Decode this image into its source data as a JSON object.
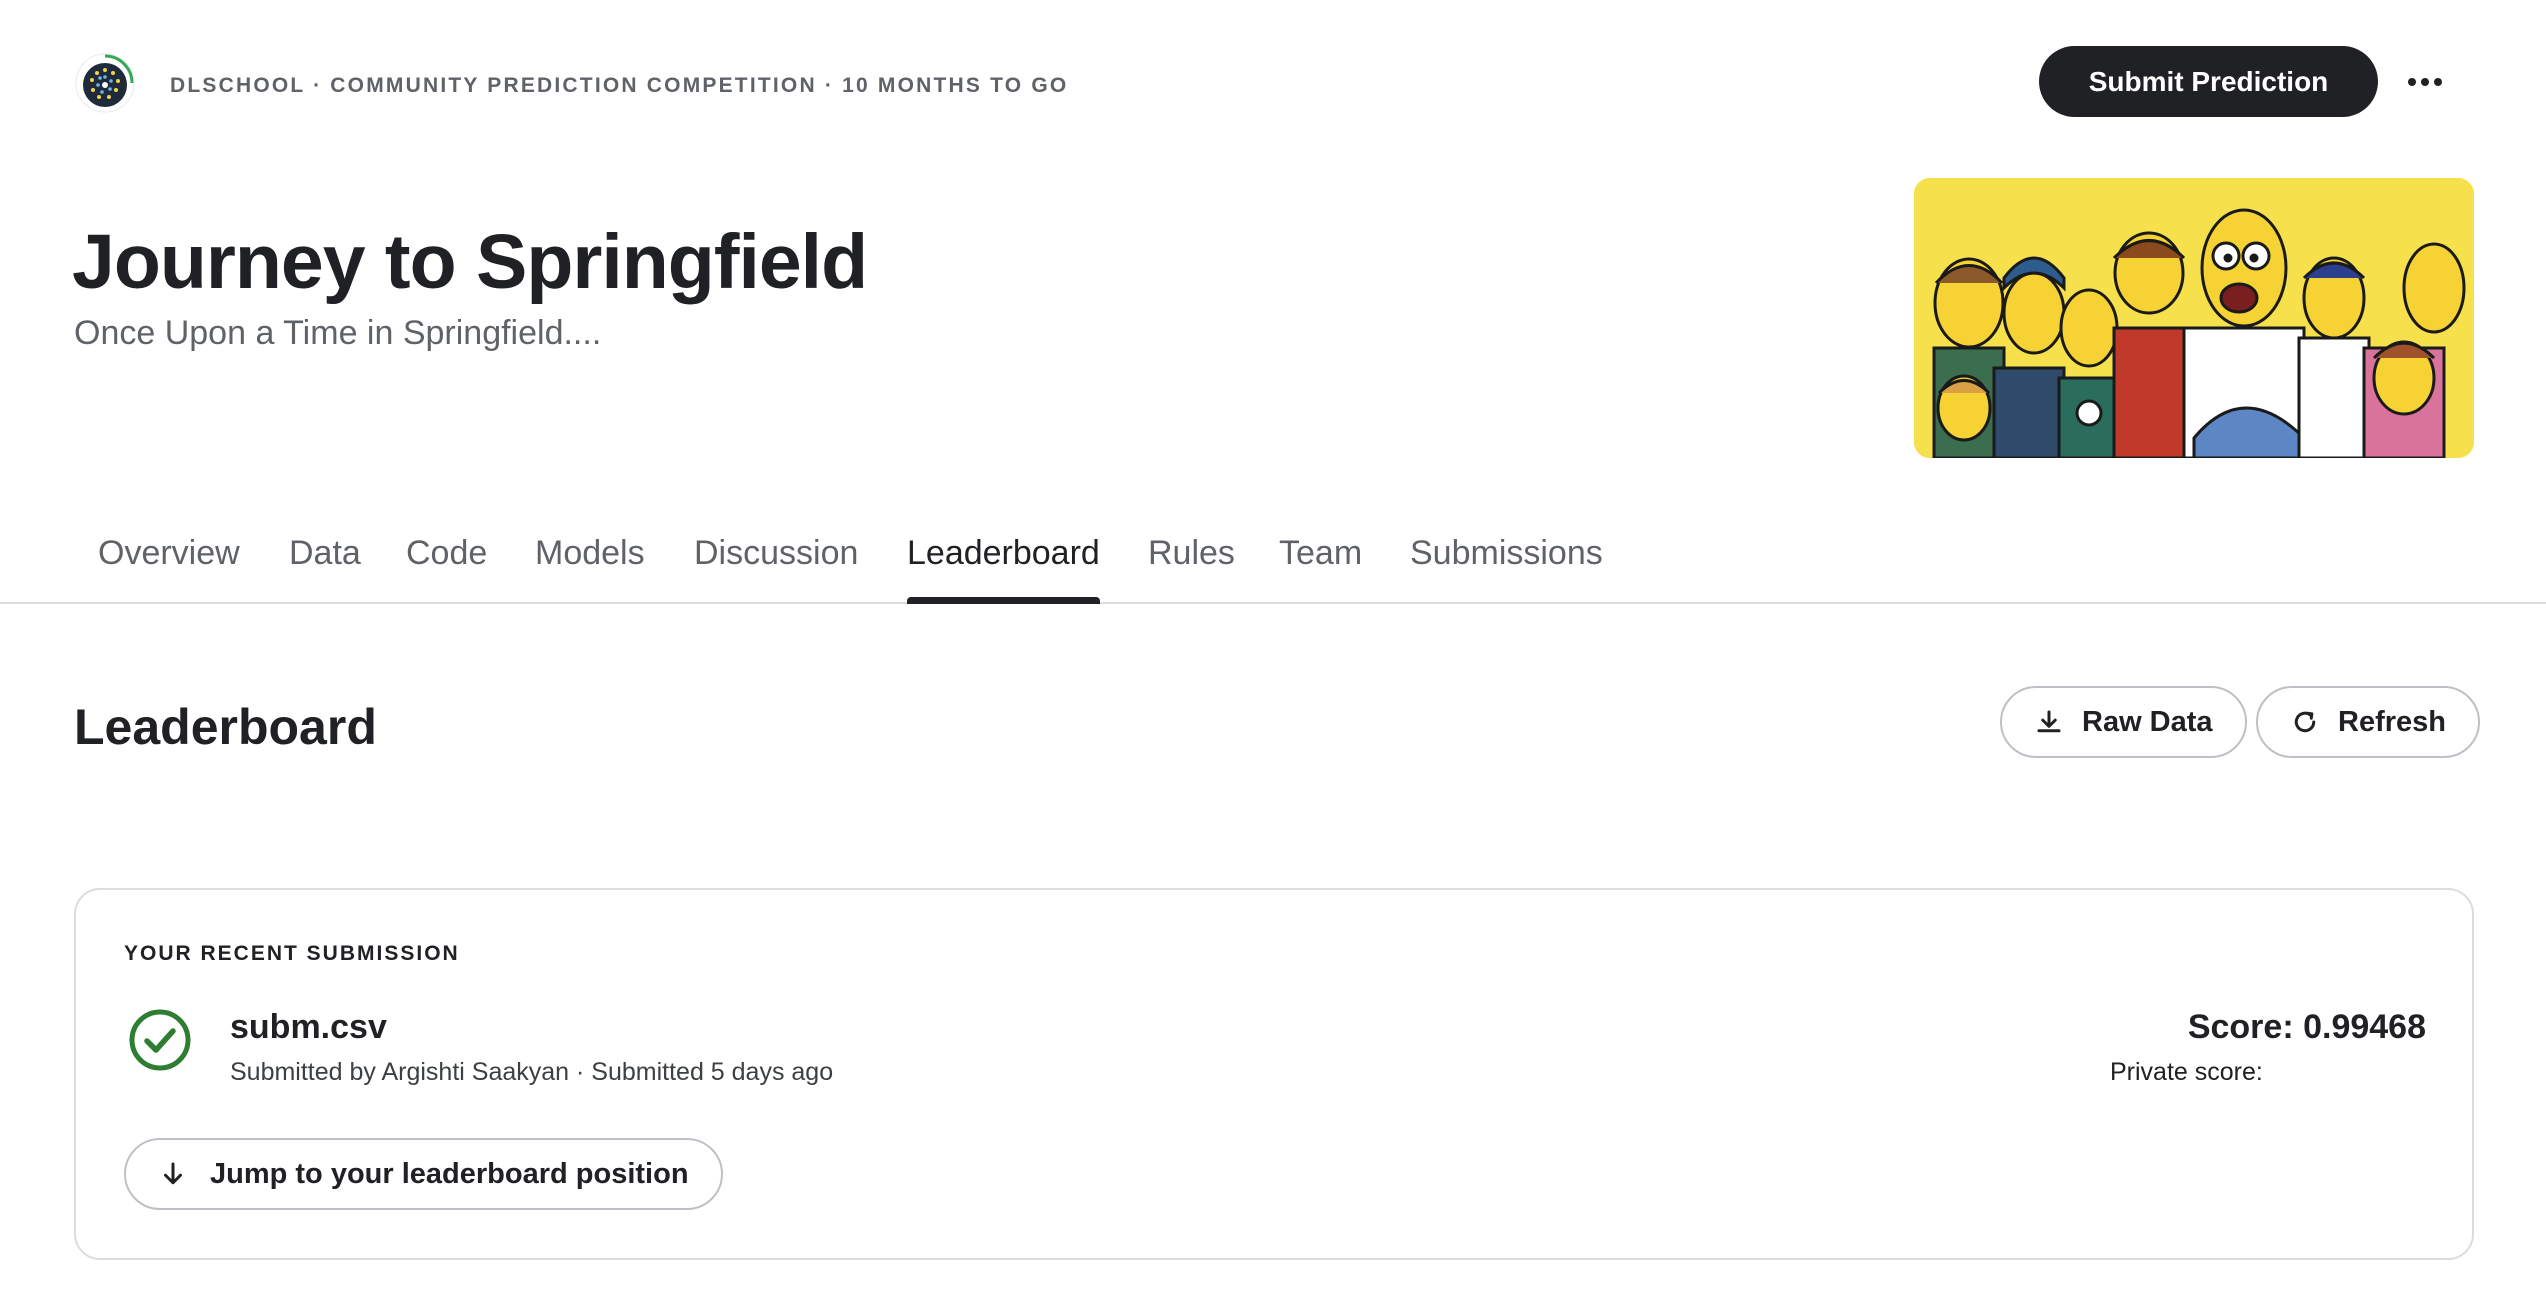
{
  "header": {
    "meta": "DLSCHOOL · COMMUNITY PREDICTION COMPETITION · 10 MONTHS TO GO",
    "submit_label": "Submit Prediction",
    "more_icon": "more-horizontal-icon"
  },
  "competition": {
    "title": "Journey to Springfield",
    "subtitle": "Once Upon a Time in Springfield...."
  },
  "tabs": [
    {
      "label": "Overview",
      "active": false
    },
    {
      "label": "Data",
      "active": false
    },
    {
      "label": "Code",
      "active": false
    },
    {
      "label": "Models",
      "active": false
    },
    {
      "label": "Discussion",
      "active": false
    },
    {
      "label": "Leaderboard",
      "active": true
    },
    {
      "label": "Rules",
      "active": false
    },
    {
      "label": "Team",
      "active": false
    },
    {
      "label": "Submissions",
      "active": false
    }
  ],
  "leaderboard": {
    "title": "Leaderboard",
    "raw_data_label": "Raw Data",
    "refresh_label": "Refresh"
  },
  "recent_submission": {
    "label": "YOUR RECENT SUBMISSION",
    "file": "subm.csv",
    "meta": "Submitted by Argishti Saakyan · Submitted 5 days ago",
    "score": "Score: 0.99468",
    "private_score": "Private score:",
    "jump_label": "Jump to your leaderboard position",
    "status_color": "#2e7d32"
  },
  "colors": {
    "primary": "#202124",
    "muted": "#5f6368",
    "border": "#dadce0",
    "banner_bg": "#f6e04b"
  }
}
